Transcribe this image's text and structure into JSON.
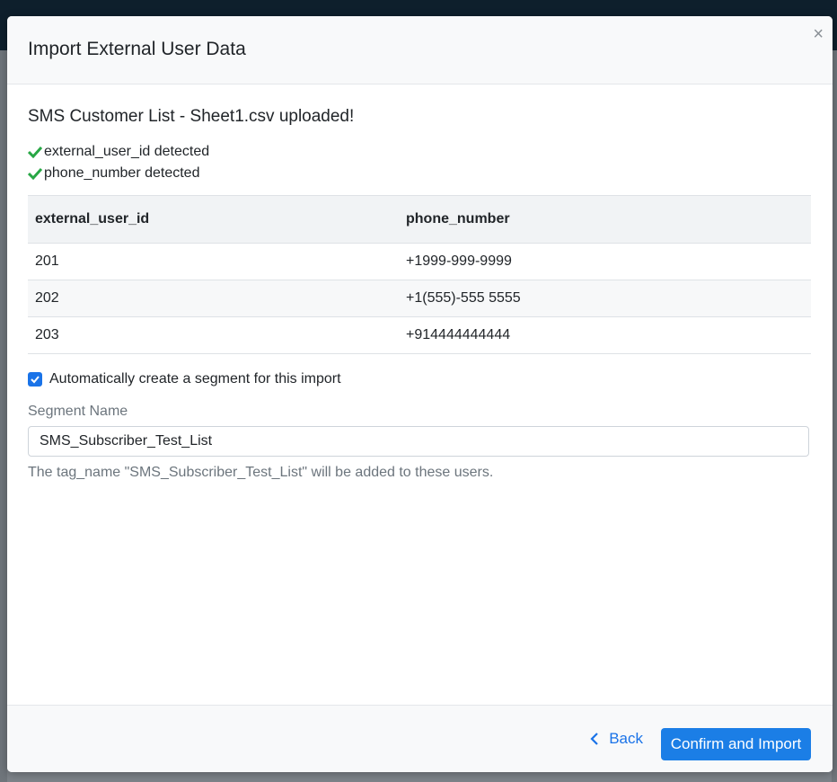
{
  "modal": {
    "title": "Import External User Data",
    "close_label": "×"
  },
  "upload": {
    "title": "SMS Customer List - Sheet1.csv uploaded!",
    "detections": [
      "external_user_id detected",
      "phone_number detected"
    ]
  },
  "table": {
    "headers": [
      "external_user_id",
      "phone_number"
    ],
    "rows": [
      [
        "201",
        "+1999-999-9999"
      ],
      [
        "202",
        "+1(555)-555 5555"
      ],
      [
        "203",
        "+914444444444"
      ]
    ]
  },
  "segment": {
    "auto_create_label": "Automatically create a segment for this import",
    "auto_create_checked": true,
    "name_label": "Segment Name",
    "name_value": "SMS_Subscriber_Test_List",
    "help_text": "The tag_name \"SMS_Subscriber_Test_List\" will be added to these users."
  },
  "footer": {
    "back_label": "Back",
    "confirm_label": "Confirm and Import"
  },
  "colors": {
    "accent": "#1b7ee6",
    "check_green": "#28a745"
  },
  "icons": [
    "close-icon",
    "check-icon",
    "chevron-left-icon",
    "checkbox-checked-icon"
  ]
}
